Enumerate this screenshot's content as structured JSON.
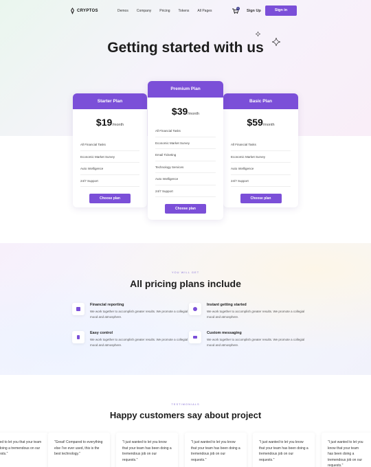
{
  "brand": {
    "name": "CRYPTOS",
    "accent": "#7b4fd8"
  },
  "nav": {
    "links": [
      "Demos",
      "Company",
      "Pricing",
      "Tokens",
      "All Pages"
    ],
    "cart_count": "0",
    "signup": "Sign Up",
    "signin": "Sign in"
  },
  "hero": {
    "title": "Getting started with us"
  },
  "plans": [
    {
      "name": "Starter Plan",
      "price": "$19",
      "period": "/month",
      "features": [
        "All Financial Tasks",
        "Economic Market Survey",
        "Auto Intelligence",
        "24/7 Support"
      ],
      "cta": "Choose plan"
    },
    {
      "name": "Premium Plan",
      "price": "$39",
      "period": "/month",
      "features": [
        "All Financial Tasks",
        "Economic Market Survey",
        "Email Ticketing",
        "Technology Services",
        "Auto Intelligence",
        "24/7 Support"
      ],
      "cta": "Choose plan"
    },
    {
      "name": "Basic Plan",
      "price": "$59",
      "period": "/month",
      "features": [
        "All Financial Tasks",
        "Economic Market Survey",
        "Auto Intelligence",
        "24/7 Support"
      ],
      "cta": "Choose plan"
    }
  ],
  "includes": {
    "eyebrow": "YOU WILL GET",
    "title": "All pricing plans include",
    "items": [
      {
        "title": "Financial reporting",
        "desc": "We work together to accomplish greater results. We promote a collegial mood and atmosphere.",
        "icon": "report-icon"
      },
      {
        "title": "Instant getting started",
        "desc": "We work together to accomplish greater results. We promote a collegial mood and atmosphere.",
        "icon": "pie-icon"
      },
      {
        "title": "Easy control",
        "desc": "We work together to accomplish greater results. We promote a collegial mood and atmosphere.",
        "icon": "phone-icon"
      },
      {
        "title": "Custom messaging",
        "desc": "We work together to accomplish greater results. We promote a collegial mood and atmosphere.",
        "icon": "mail-icon"
      }
    ]
  },
  "testimonials": {
    "eyebrow": "TESTIMONIALS",
    "title": "Happy customers say about project",
    "quotes": [
      "wanted to let you that your team has doing a tremendous on our requests.\"",
      "\"Great! Compared to everything else I've ever used, this is the best technology.\"",
      "\"I just wanted to let you know that your team has been doing a tremendous job on our requests.\"",
      "\"I just wanted to let you know that your team has been doing a tremendous job on our requests.\"",
      "\"I just wanted to let you know that your team has been doing a tremendous job on our requests.\"",
      "\"I just wanted to let you know that your team has been doing a tremendous job on our requests.\""
    ]
  }
}
